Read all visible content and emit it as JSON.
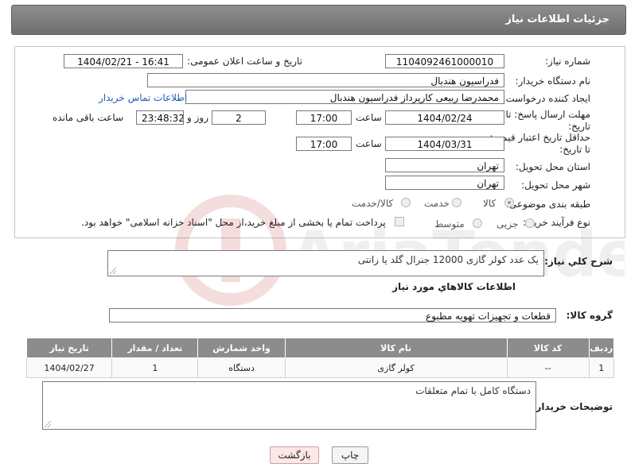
{
  "header": {
    "title": "جزئیات اطلاعات نیاز"
  },
  "form": {
    "need_number": {
      "label": "شماره نیاز:",
      "value": "1104092461000010"
    },
    "announce_datetime": {
      "label": "تاریخ و ساعت اعلان عمومی:",
      "value": "1404/02/21 - 16:41"
    },
    "buyer_org": {
      "label": "نام دستگاه خریدار:",
      "value": "فدراسیون هندبال"
    },
    "requester": {
      "label": "ایجاد کننده درخواست:",
      "value": "محمدرضا ربیعی کارپرداز فدراسیون هندبال",
      "contact_link": "اطلاعات تماس خریدار"
    },
    "reply_deadline": {
      "label_line1": "مهلت ارسال پاسخ: تا",
      "label_line2": "تاریخ:",
      "date": "1404/02/24",
      "time_label": "ساعت",
      "time": "17:00",
      "days": "2",
      "days_label": "روز و",
      "remaining": "23:48:32",
      "remaining_label": "ساعت باقی مانده"
    },
    "price_validity": {
      "label_line1": "حداقل تاریخ اعتبار قیمت:",
      "label_line2": "تا تاریخ:",
      "date": "1404/03/31",
      "time_label": "ساعت",
      "time": "17:00"
    },
    "delivery_province": {
      "label": "استان محل تحویل:",
      "value": "تهران"
    },
    "delivery_city": {
      "label": "شهر محل تحویل:",
      "value": "تهران"
    },
    "category": {
      "label": "طبقه بندی موضوعی:",
      "options": [
        "کالا",
        "خدمت",
        "کالا/خدمت"
      ],
      "selected": "کالا"
    },
    "purchase_process": {
      "label": "نوع فرآیند خرید :",
      "options": [
        "جزیی",
        "متوسط"
      ],
      "payment_note": "پرداخت تمام یا بخشی از مبلغ خرید،از محل \"اسناد خزانه اسلامی\" خواهد بود."
    }
  },
  "description": {
    "label": "شرح کلي نياز:",
    "value": "یک عدد کولر گازی 12000 جنرال گلد یا زانتی"
  },
  "goods_section": {
    "title": "اطلاعات كالاهاي مورد نياز"
  },
  "goods_group": {
    "label": "گروه کالا:",
    "value": "قطعات و تجهیزات تهویه مطبوع"
  },
  "table": {
    "headers": [
      "ردیف",
      "کد کالا",
      "نام کالا",
      "واحد شمارش",
      "تعداد / مقدار",
      "تاریخ نیاز"
    ],
    "rows": [
      [
        "1",
        "--",
        "کولر گازی",
        "دستگاه",
        "1",
        "1404/02/27"
      ]
    ]
  },
  "buyer_notes": {
    "label": "توضیحات خریدار:",
    "value": "دستگاه کامل با تمام متعلقات"
  },
  "buttons": {
    "print": "چاپ",
    "back": "بازگشت"
  },
  "watermark": {
    "text": "AriaTender.neT"
  },
  "colors": {
    "header_bg": "#7f7f7f",
    "link": "#1d5fb5",
    "table_header": "#8c8c8c",
    "back_button": "#fde7e7"
  }
}
